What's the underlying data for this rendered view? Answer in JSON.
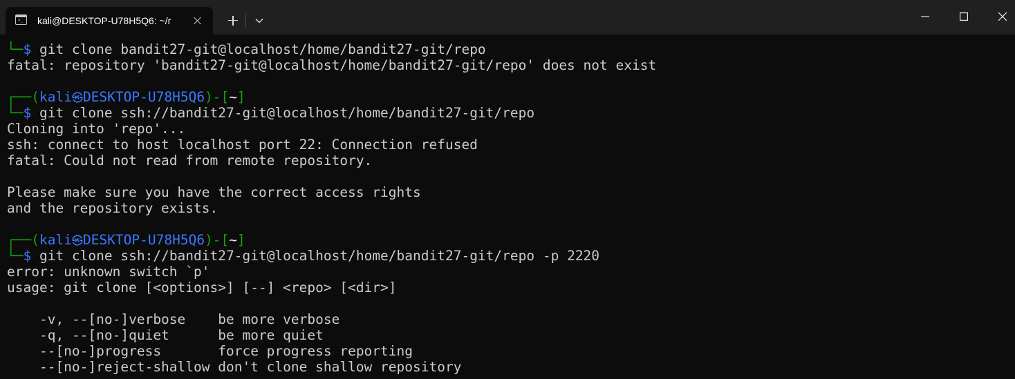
{
  "window": {
    "tab_title": "kali@DESKTOP-U78H5Q6: ~/r",
    "tab_icon": "terminal-icon",
    "new_tab_icon": "plus-icon",
    "dropdown_icon": "chevron-down-icon",
    "controls": [
      "minimize-icon",
      "maximize-icon",
      "close-icon"
    ]
  },
  "colors": {
    "background": "#0c0c0c",
    "titlebar": "#202020",
    "text": "#cccccc",
    "prompt_green": "#13a10e",
    "prompt_blue": "#3b78ff"
  },
  "prompt": {
    "open": "┌──(",
    "user": "kali",
    "separator": "㉿",
    "host": "DESKTOP-U78H5Q6",
    "mid": ")-[",
    "dir": "~",
    "close": "]",
    "cmd_prefix": "└─",
    "dollar": "$"
  },
  "terminal": {
    "lines": [
      {
        "type": "command",
        "command": " git clone bandit27-git@localhost/home/bandit27-git/repo"
      },
      {
        "type": "output",
        "text": "fatal: repository 'bandit27-git@localhost/home/bandit27-git/repo' does not exist"
      },
      {
        "type": "output",
        "text": ""
      },
      {
        "type": "prompt"
      },
      {
        "type": "command",
        "command": " git clone ssh://bandit27-git@localhost/home/bandit27-git/repo"
      },
      {
        "type": "output",
        "text": "Cloning into 'repo'..."
      },
      {
        "type": "output",
        "text": "ssh: connect to host localhost port 22: Connection refused"
      },
      {
        "type": "output",
        "text": "fatal: Could not read from remote repository."
      },
      {
        "type": "output",
        "text": ""
      },
      {
        "type": "output",
        "text": "Please make sure you have the correct access rights"
      },
      {
        "type": "output",
        "text": "and the repository exists."
      },
      {
        "type": "output",
        "text": ""
      },
      {
        "type": "prompt"
      },
      {
        "type": "command",
        "command": " git clone ssh://bandit27-git@localhost/home/bandit27-git/repo -p 2220"
      },
      {
        "type": "output",
        "text": "error: unknown switch `p'"
      },
      {
        "type": "output",
        "text": "usage: git clone [<options>] [--] <repo> [<dir>]"
      },
      {
        "type": "output",
        "text": ""
      },
      {
        "type": "output",
        "text": "    -v, --[no-]verbose    be more verbose"
      },
      {
        "type": "output",
        "text": "    -q, --[no-]quiet      be more quiet"
      },
      {
        "type": "output",
        "text": "    --[no-]progress       force progress reporting"
      },
      {
        "type": "output",
        "text": "    --[no-]reject-shallow don't clone shallow repository"
      }
    ]
  }
}
